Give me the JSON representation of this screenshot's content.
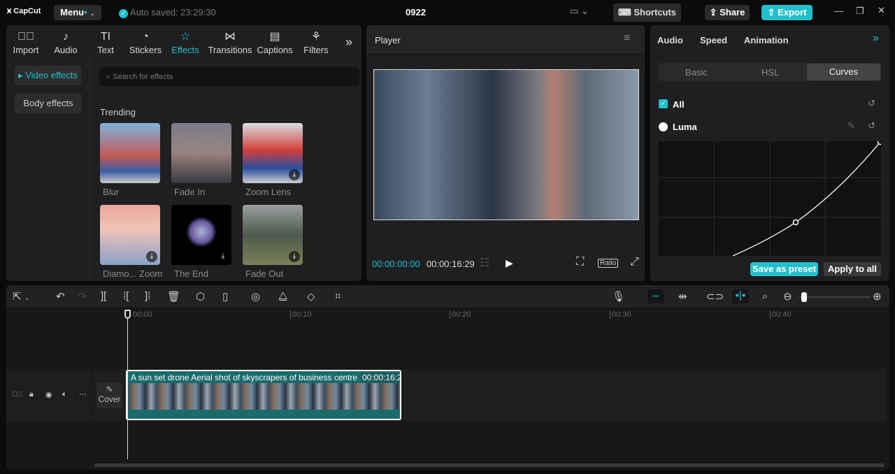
{
  "app": {
    "logo": "CapCut",
    "menu": "Menu",
    "autosave": "Auto saved: 23:29:30",
    "project": "0922",
    "shortcuts": "Shortcuts",
    "share": "Share",
    "export": "Export"
  },
  "tabs": [
    {
      "label": "Import",
      "icon": "import-icon"
    },
    {
      "label": "Audio",
      "icon": "audio-icon"
    },
    {
      "label": "Text",
      "icon": "text-icon"
    },
    {
      "label": "Stickers",
      "icon": "stickers-icon"
    },
    {
      "label": "Effects",
      "icon": "effects-icon"
    },
    {
      "label": "Transitions",
      "icon": "transitions-icon"
    },
    {
      "label": "Captions",
      "icon": "captions-icon"
    },
    {
      "label": "Filters",
      "icon": "filters-icon"
    }
  ],
  "sidebar": {
    "video_effects": "Video effects",
    "body_effects": "Body effects"
  },
  "search": {
    "placeholder": "Search for effects"
  },
  "trending": {
    "title": "Trending",
    "items": [
      "Blur",
      "Fade In",
      "Zoom Lens",
      "Diamo... Zoom",
      "The End",
      "Fade Out"
    ]
  },
  "player": {
    "title": "Player",
    "current": "00:00:00:00",
    "total": "00:00:16:29",
    "ratio": "Ratio"
  },
  "right": {
    "tabs": [
      "Audio",
      "Speed",
      "Animation"
    ],
    "subtabs": [
      "Basic",
      "HSL",
      "Curves"
    ],
    "all": "All",
    "luma": "Luma",
    "save_preset": "Save as preset",
    "apply_all": "Apply to all"
  },
  "timeline": {
    "ticks": [
      "00:00",
      "00:10",
      "00:20",
      "00:30",
      "00:40"
    ],
    "cover": "Cover",
    "clip_title": "A sun set drone Aerial shot of skyscrapers of  business centre",
    "clip_duration": "00:00:16:2"
  },
  "colors": {
    "accent": "#22c0cc",
    "clip": "#1b6b6b"
  }
}
